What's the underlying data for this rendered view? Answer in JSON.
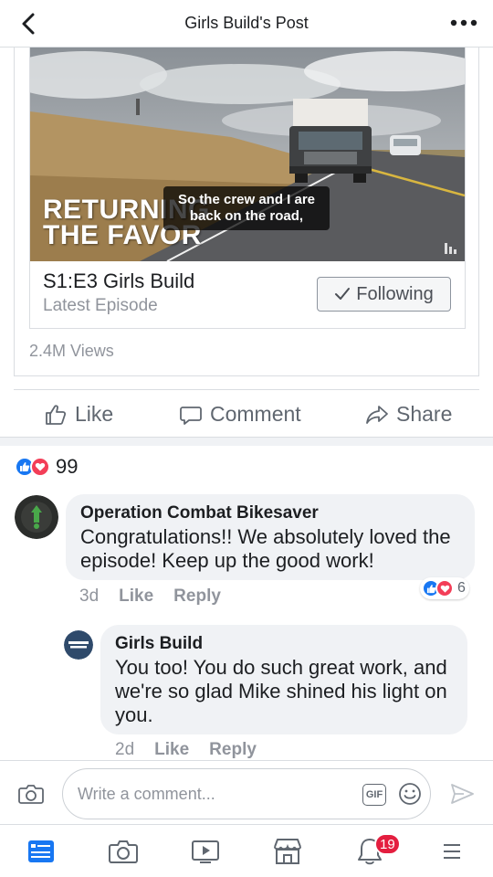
{
  "header": {
    "title": "Girls Build's Post"
  },
  "video": {
    "brand_line1": "RETURNING",
    "brand_line2": "THE FAVOR",
    "caption": "So the crew and I are back on the road,"
  },
  "episode": {
    "title": "S1:E3 Girls Build",
    "subtitle": "Latest Episode",
    "follow_label": "Following"
  },
  "views": "2.4M Views",
  "actions": {
    "like": "Like",
    "comment": "Comment",
    "share": "Share"
  },
  "reactions": {
    "count": "99"
  },
  "comments": [
    {
      "author": "Operation Combat Bikesaver",
      "text": "Congratulations!! We absolutely loved the episode! Keep up the good work!",
      "time": "3d",
      "like": "Like",
      "reply": "Reply",
      "reaction_count": "6"
    },
    {
      "author": "Girls Build",
      "text": "You too! You do such great work, and we're so glad Mike shined his light on you.",
      "time": "2d",
      "like": "Like",
      "reply": "Reply"
    }
  ],
  "composer": {
    "placeholder": "Write a comment...",
    "gif_label": "GIF"
  },
  "tabbar": {
    "notifications_badge": "19"
  },
  "colors": {
    "accent": "#1877f2",
    "love": "#f33e58",
    "badge": "#e41e3f"
  }
}
